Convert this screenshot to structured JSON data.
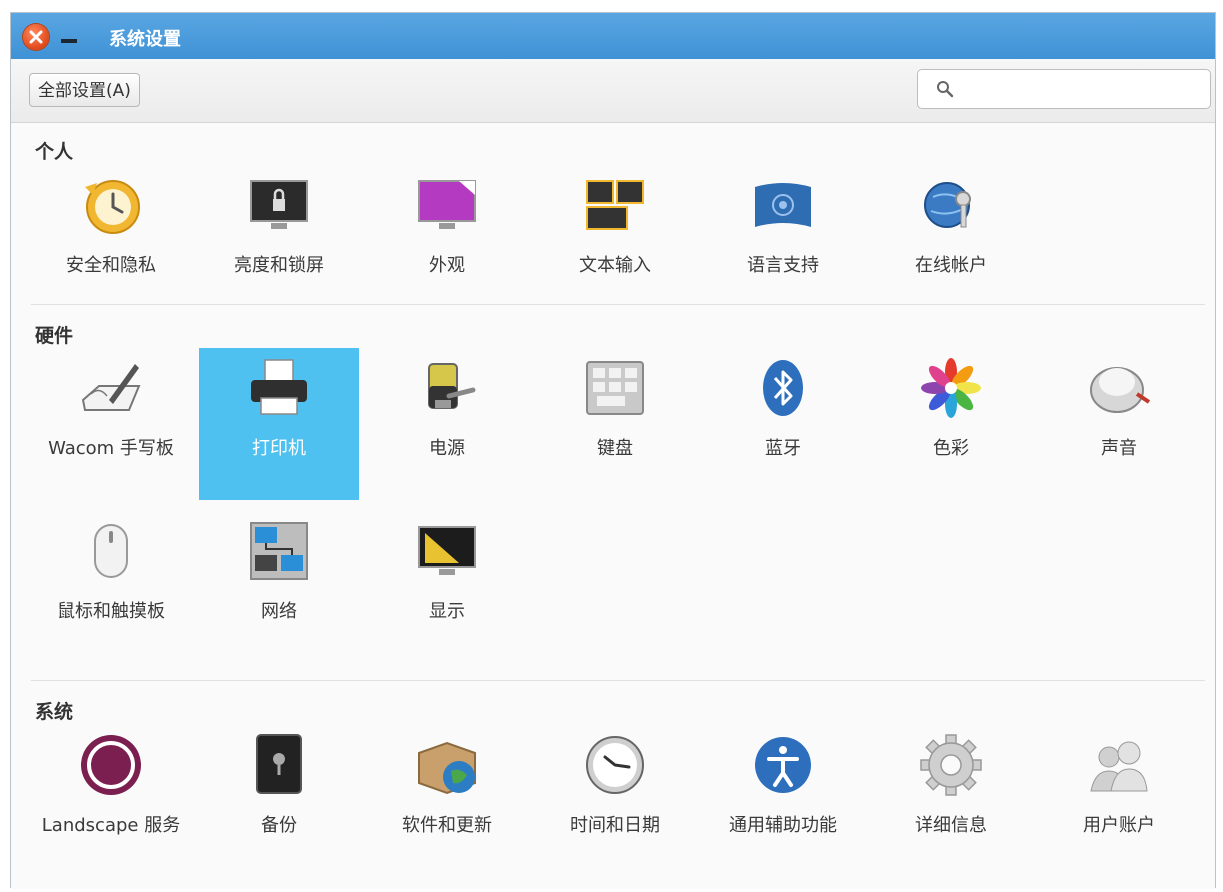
{
  "window": {
    "title": "系统设置"
  },
  "toolbar": {
    "all_settings_label": "全部设置(A)",
    "search_placeholder": ""
  },
  "sections": [
    {
      "title": "个人",
      "items": [
        {
          "label": "安全和隐私",
          "icon": "security-clock-icon"
        },
        {
          "label": "亮度和锁屏",
          "icon": "lock-screen-icon"
        },
        {
          "label": "外观",
          "icon": "appearance-icon"
        },
        {
          "label": "文本输入",
          "icon": "text-input-icon"
        },
        {
          "label": "语言支持",
          "icon": "language-flag-icon"
        },
        {
          "label": "在线帐户",
          "icon": "online-accounts-icon"
        }
      ]
    },
    {
      "title": "硬件",
      "items": [
        {
          "label": "Wacom 手写板",
          "icon": "wacom-tablet-icon"
        },
        {
          "label": "打印机",
          "icon": "printer-icon",
          "selected": true
        },
        {
          "label": "电源",
          "icon": "battery-plug-icon"
        },
        {
          "label": "键盘",
          "icon": "keyboard-icon"
        },
        {
          "label": "蓝牙",
          "icon": "bluetooth-icon"
        },
        {
          "label": "色彩",
          "icon": "color-flower-icon"
        },
        {
          "label": "声音",
          "icon": "sound-knob-icon"
        },
        {
          "label": "鼠标和触摸板",
          "icon": "mouse-icon"
        },
        {
          "label": "网络",
          "icon": "network-icon"
        },
        {
          "label": "显示",
          "icon": "display-icon"
        }
      ]
    },
    {
      "title": "系统",
      "items": [
        {
          "label": "Landscape 服务",
          "icon": "landscape-icon"
        },
        {
          "label": "备份",
          "icon": "backup-safe-icon"
        },
        {
          "label": "软件和更新",
          "icon": "software-updates-icon"
        },
        {
          "label": "时间和日期",
          "icon": "clock-icon"
        },
        {
          "label": "通用辅助功能",
          "icon": "accessibility-icon"
        },
        {
          "label": "详细信息",
          "icon": "gear-icon"
        },
        {
          "label": "用户账户",
          "icon": "user-accounts-icon"
        }
      ]
    }
  ]
}
